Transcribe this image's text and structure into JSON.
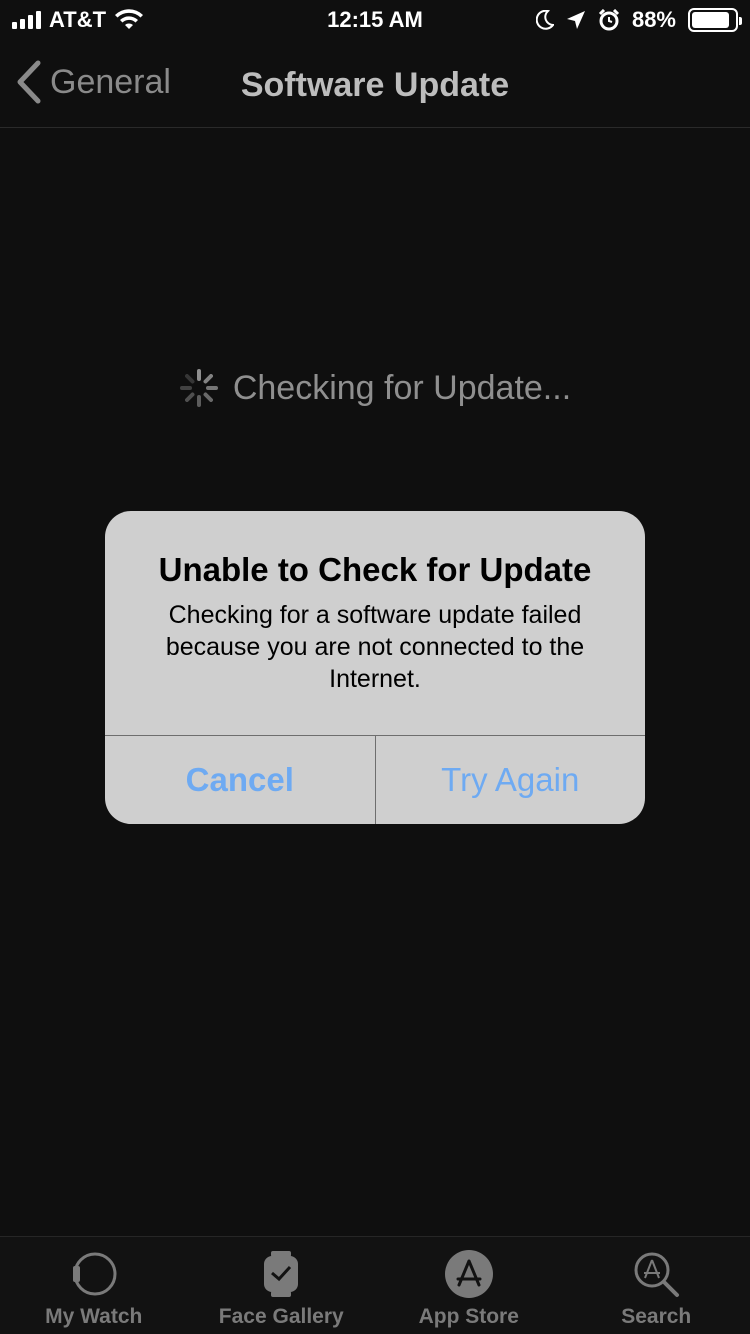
{
  "status_bar": {
    "carrier": "AT&T",
    "time": "12:15 AM",
    "battery": "88%",
    "icons": [
      "signal-icon",
      "wifi-icon",
      "moon-icon",
      "location-icon",
      "alarm-icon",
      "battery-icon"
    ]
  },
  "nav": {
    "back_label": "General",
    "title": "Software Update"
  },
  "content": {
    "checking_text": "Checking for Update..."
  },
  "alert": {
    "title": "Unable to Check for Update",
    "message": "Checking for a software update failed because you are not connected to the Internet.",
    "cancel_label": "Cancel",
    "retry_label": "Try Again"
  },
  "tabs": [
    {
      "label": "My Watch",
      "icon": "watch-icon"
    },
    {
      "label": "Face Gallery",
      "icon": "face-gallery-icon"
    },
    {
      "label": "App Store",
      "icon": "app-store-icon"
    },
    {
      "label": "Search",
      "icon": "search-icon"
    }
  ],
  "colors": {
    "background": "#0f0f0f",
    "alert_bg": "#cfcfcf",
    "accent": "#6eaaf2"
  }
}
